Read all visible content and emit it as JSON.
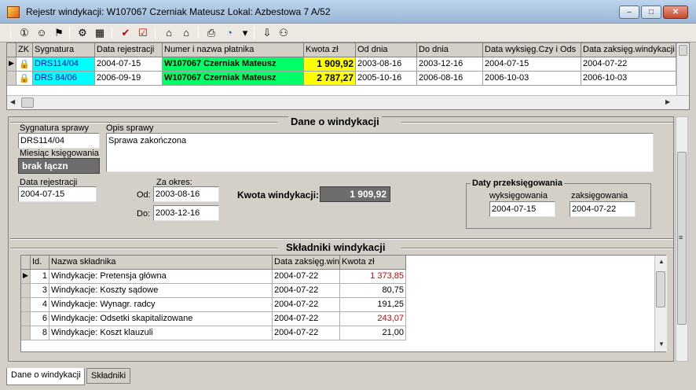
{
  "window": {
    "title": "Rejestr windykacji: W107067 Czerniak Mateusz  Lokal: Azbestowa 7 A/52",
    "min_glyph": "–",
    "max_glyph": "□",
    "close_glyph": "✕"
  },
  "toolbar": {
    "icons": [
      "info-icon",
      "users-icon",
      "filter-icon",
      "properties-icon",
      "grid-icon",
      "check-icon",
      "checkbox-icon",
      "lock-icon",
      "unlock-icon",
      "print-icon",
      "chart-icon",
      "dropdown-icon",
      "export-icon",
      "user-key-icon"
    ],
    "glyphs": [
      "①",
      "☺",
      "⚑",
      "⚙",
      "▦",
      "✔",
      "☑",
      "⌂",
      "⌂",
      "⎙",
      "◔",
      "▾",
      "⇩",
      "⚇"
    ]
  },
  "upper_grid": {
    "columns": [
      "ZK",
      "Sygnatura",
      "Data rejestracji",
      "Numer i nazwa płatnika",
      "Kwota zł",
      "Od dnia",
      "Do dnia",
      "Data wyksięg.Czy i Ods",
      "Data zaksięg.windykacji"
    ],
    "rows": [
      {
        "sygnatura": "DRS114/04",
        "data_rej": "2004-07-15",
        "platnik": "W107067 Czerniak Mateusz",
        "kwota": "1 909,92",
        "od": "2003-08-16",
        "do": "2003-12-16",
        "wyks": "2004-07-15",
        "zaks": "2004-07-22"
      },
      {
        "sygnatura": "DRS 84/06",
        "data_rej": "2006-09-19",
        "platnik": "W107067 Czerniak Mateusz",
        "kwota": "2 787,27",
        "od": "2005-10-16",
        "do": "2006-08-16",
        "wyks": "2006-10-03",
        "zaks": "2006-10-03"
      }
    ],
    "colors": {
      "sygnatura_bg": "#00ffff",
      "platnik_bg": "#00ff66",
      "kwota_bg": "#ffff00"
    }
  },
  "dane": {
    "title": "Dane o windykacji",
    "sygnatura_label": "Sygnatura sprawy",
    "sygnatura_value": "DRS114/04",
    "opis_label": "Opis sprawy",
    "opis_value": "Sprawa zakończona",
    "miesiac_label": "Miesiąc księgowania",
    "miesiac_value": "brak łączn",
    "data_rej_label": "Data rejestracji",
    "data_rej_value": "2004-07-15",
    "za_okres_label": "Za okres:",
    "od_label": "Od:",
    "od_value": "2003-08-16",
    "do_label": "Do:",
    "do_value": "2003-12-16",
    "kwota_label": "Kwota windykacji:",
    "kwota_value": "1 909,92",
    "daty_title": "Daty przeksięgowania",
    "wyks_label": "wyksięgowania",
    "wyks_value": "2004-07-15",
    "zaks_label": "zaksięgowania",
    "zaks_value": "2004-07-22"
  },
  "skladniki": {
    "title": "Składniki windykacji",
    "columns": [
      "Id.",
      "Nazwa składnika",
      "Data zaksięg.win",
      "Kwota zł"
    ],
    "rows": [
      {
        "id": "1",
        "nazwa": "Windykacje: Pretensja główna",
        "data": "2004-07-22",
        "kwota": "1 373,85",
        "red": true
      },
      {
        "id": "3",
        "nazwa": "Windykacje: Koszty sądowe",
        "data": "2004-07-22",
        "kwota": "80,75",
        "red": false
      },
      {
        "id": "4",
        "nazwa": "Windykacje: Wynagr. radcy",
        "data": "2004-07-22",
        "kwota": "191,25",
        "red": false
      },
      {
        "id": "6",
        "nazwa": "Windykacje: Odsetki skapitalizowane",
        "data": "2004-07-22",
        "kwota": "243,07",
        "red": true
      },
      {
        "id": "8",
        "nazwa": "Windykacje: Koszt klauzuli",
        "data": "2004-07-22",
        "kwota": "21,00",
        "red": false
      }
    ]
  },
  "tabs": [
    "Dane o windykacji",
    "Składniki"
  ]
}
